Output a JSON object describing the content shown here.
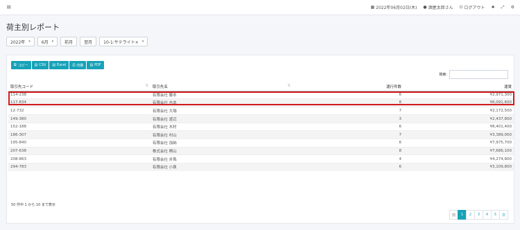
{
  "topbar": {
    "date": "2022年06月02日(木)",
    "user": "酒屋太郎さん",
    "logout": "ログアウト"
  },
  "page": {
    "title": "荷主別レポート"
  },
  "filters": {
    "year": "2022年",
    "month": "6月",
    "prev": "前月",
    "next": "翌月",
    "shipper": "10-1:サテライト×"
  },
  "export": {
    "copy": "コピー",
    "csv": "CSV",
    "excel": "Excel",
    "print": "印刷",
    "pdf": "PDF"
  },
  "search": {
    "label": "検索:",
    "value": ""
  },
  "table": {
    "headers": [
      "取引先コード",
      "取引先名",
      "運行件数",
      "運賃"
    ],
    "rows": [
      [
        "114-238",
        "有限会社 藤本",
        "6",
        "¥2,971,300"
      ],
      [
        "117-834",
        "有限会社 吉本",
        "8",
        "¥6,091,600"
      ],
      [
        "12-732",
        "有限会社 大場",
        "7",
        "¥2,172,500"
      ],
      [
        "149-380",
        "有限会社 渡辺",
        "3",
        "¥2,437,800"
      ],
      [
        "152-188",
        "有限会社 木村",
        "6",
        "¥8,401,400"
      ],
      [
        "186-307",
        "有限会社 村山",
        "7",
        "¥3,389,000"
      ],
      [
        "195-840",
        "有限会社 加納",
        "6",
        "¥7,975,700"
      ],
      [
        "207-638",
        "株式会社 桐山",
        "8",
        "¥7,686,100"
      ],
      [
        "208-863",
        "有限会社 井馬",
        "4",
        "¥4,274,800"
      ],
      [
        "294-783",
        "有限会社 小泉",
        "6",
        "¥3,109,800"
      ]
    ]
  },
  "info": "50 件中 1 から 10 まで表示",
  "pager": {
    "prev": "前",
    "pages": [
      "1",
      "2",
      "3",
      "4",
      "5"
    ],
    "next": "次"
  }
}
